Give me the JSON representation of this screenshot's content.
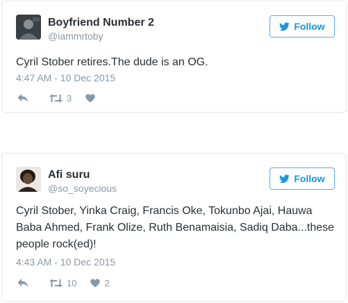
{
  "tweets": [
    {
      "display_name": "Boyfriend Number 2",
      "handle": "@iammrtoby",
      "follow_label": "Follow",
      "text": "Cyril Stober retires.The dude is an OG.",
      "timestamp": "4:47 AM - 10 Dec 2015",
      "retweet_count": "3",
      "like_count": "",
      "avatar_icon": "user-avatar"
    },
    {
      "display_name": "Afi suru",
      "handle": "@so_soyecious",
      "follow_label": "Follow",
      "text": "Cyril Stober, Yinka Craig, Francis Oke, Tokunbo Ajai, Hauwa Baba Ahmed, Frank Olize, Ruth Benamaisia, Sadiq Daba...these people rock(ed)!",
      "timestamp": "4:43 AM - 10 Dec 2015",
      "retweet_count": "10",
      "like_count": "2",
      "avatar_icon": "user-avatar"
    }
  ],
  "colors": {
    "accent": "#1b95e0",
    "border": "#e1e8ed",
    "muted": "#8899a6",
    "text": "#292f33"
  },
  "icons": {
    "follow": "twitter-bird-icon",
    "reply": "reply-icon",
    "retweet": "retweet-icon",
    "like": "heart-icon"
  }
}
